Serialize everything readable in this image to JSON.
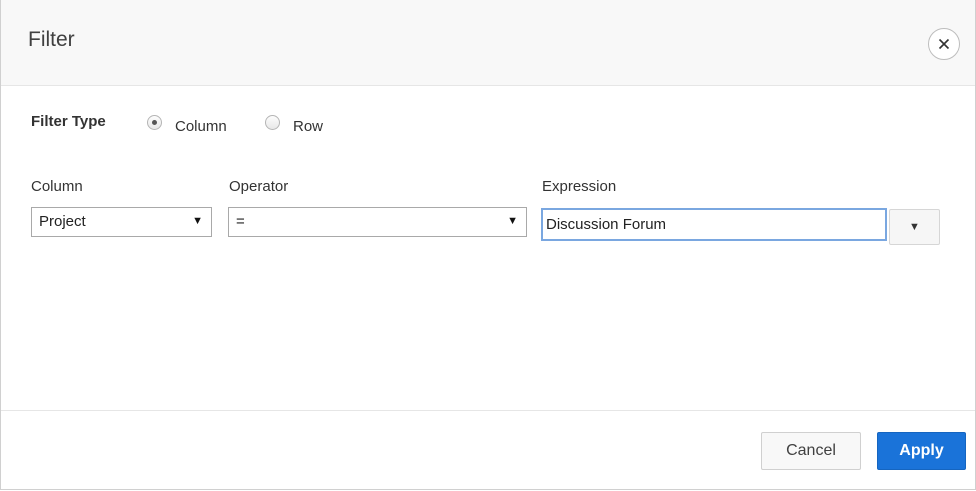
{
  "dialog": {
    "title": "Filter",
    "close_icon": "close-icon"
  },
  "filter_type": {
    "label": "Filter Type",
    "options": [
      {
        "label": "Column",
        "checked": true
      },
      {
        "label": "Row",
        "checked": false
      }
    ]
  },
  "fields": {
    "column": {
      "label": "Column",
      "value": "Project"
    },
    "operator": {
      "label": "Operator",
      "value": "="
    },
    "expression": {
      "label": "Expression",
      "value": "Discussion Forum"
    }
  },
  "footer": {
    "cancel_label": "Cancel",
    "apply_label": "Apply"
  },
  "colors": {
    "apply_button": "#1a73d9",
    "input_focus_border": "#7aa7e0"
  }
}
